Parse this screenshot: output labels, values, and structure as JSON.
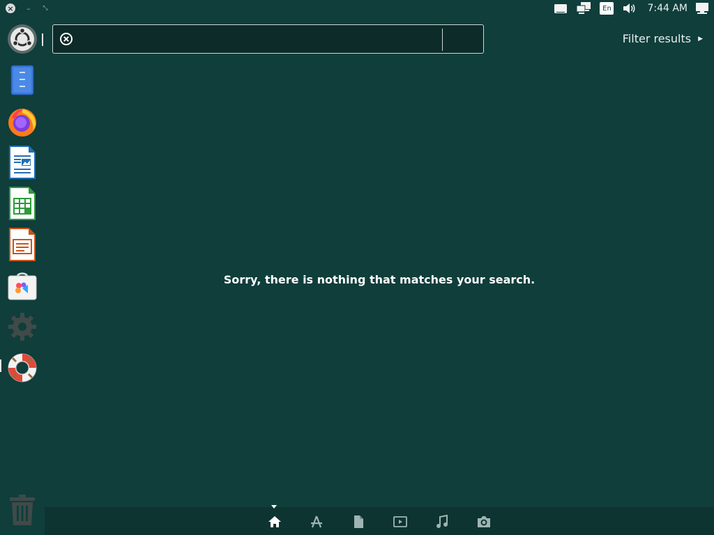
{
  "top_panel": {
    "clock": "7:44 AM",
    "language": "En"
  },
  "launcher": {
    "items": [
      {
        "name": "ubuntu-dash",
        "icon": "ubuntu-logo-icon"
      },
      {
        "name": "files",
        "icon": "files-icon"
      },
      {
        "name": "firefox",
        "icon": "firefox-icon"
      },
      {
        "name": "libreoffice-writer",
        "icon": "writer-icon"
      },
      {
        "name": "libreoffice-calc",
        "icon": "calc-icon"
      },
      {
        "name": "libreoffice-impress",
        "icon": "impress-icon"
      },
      {
        "name": "ubuntu-software",
        "icon": "software-store-icon"
      },
      {
        "name": "system-settings",
        "icon": "gear-icon"
      },
      {
        "name": "help",
        "icon": "lifebuoy-icon"
      },
      {
        "name": "trash",
        "icon": "trash-icon"
      }
    ]
  },
  "search": {
    "value": "",
    "placeholder": ""
  },
  "filter": {
    "label": "Filter results"
  },
  "message": {
    "no_results": "Sorry, there is nothing that matches your search."
  },
  "lenses": [
    {
      "name": "home",
      "icon": "home-icon"
    },
    {
      "name": "applications",
      "icon": "applications-icon"
    },
    {
      "name": "files",
      "icon": "document-icon"
    },
    {
      "name": "video",
      "icon": "video-icon"
    },
    {
      "name": "music",
      "icon": "music-icon"
    },
    {
      "name": "photos",
      "icon": "camera-icon"
    }
  ],
  "colors": {
    "background": "#0f3e3b",
    "lens_bar": "#0d3431",
    "search_bg": "#0c2b29"
  }
}
